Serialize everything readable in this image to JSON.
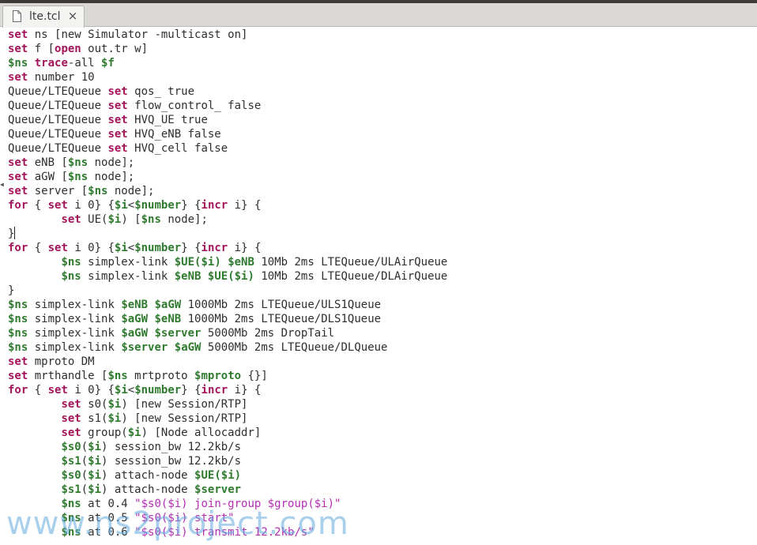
{
  "tab": {
    "title": "lte.tcl",
    "close": "×",
    "icon": "document-icon"
  },
  "watermark": "www.ns2project.com",
  "code": [
    [
      [
        "kw",
        "set"
      ],
      [
        "p",
        " ns [new Simulator -multicast on]"
      ]
    ],
    [
      [
        "kw",
        "set"
      ],
      [
        "p",
        " f ["
      ],
      [
        "kw",
        "open"
      ],
      [
        "p",
        " out.tr w]"
      ]
    ],
    [
      [
        "var",
        "$ns"
      ],
      [
        "p",
        " "
      ],
      [
        "kw",
        "trace"
      ],
      [
        "p",
        "-all "
      ],
      [
        "var",
        "$f"
      ]
    ],
    [
      [
        "kw",
        "set"
      ],
      [
        "p",
        " number 10"
      ]
    ],
    [
      [
        "p",
        "Queue/LTEQueue "
      ],
      [
        "kw",
        "set"
      ],
      [
        "p",
        " qos_ true"
      ]
    ],
    [
      [
        "p",
        "Queue/LTEQueue "
      ],
      [
        "kw",
        "set"
      ],
      [
        "p",
        " flow_control_ false"
      ]
    ],
    [
      [
        "p",
        "Queue/LTEQueue "
      ],
      [
        "kw",
        "set"
      ],
      [
        "p",
        " HVQ_UE true"
      ]
    ],
    [
      [
        "p",
        "Queue/LTEQueue "
      ],
      [
        "kw",
        "set"
      ],
      [
        "p",
        " HVQ_eNB false"
      ]
    ],
    [
      [
        "p",
        "Queue/LTEQueue "
      ],
      [
        "kw",
        "set"
      ],
      [
        "p",
        " HVQ_cell false"
      ]
    ],
    [
      [
        "kw",
        "set"
      ],
      [
        "p",
        " eNB ["
      ],
      [
        "var",
        "$ns"
      ],
      [
        "p",
        " node];"
      ]
    ],
    [
      [
        "kw",
        "set"
      ],
      [
        "p",
        " aGW ["
      ],
      [
        "var",
        "$ns"
      ],
      [
        "p",
        " node];"
      ]
    ],
    [
      [
        "kw",
        "set"
      ],
      [
        "p",
        " server ["
      ],
      [
        "var",
        "$ns"
      ],
      [
        "p",
        " node];"
      ]
    ],
    [
      [
        "kw",
        "for"
      ],
      [
        "p",
        " { "
      ],
      [
        "kw",
        "set"
      ],
      [
        "p",
        " i 0} {"
      ],
      [
        "var",
        "$i"
      ],
      [
        "p",
        "<"
      ],
      [
        "var",
        "$number"
      ],
      [
        "p",
        "} {"
      ],
      [
        "kw",
        "incr"
      ],
      [
        "p",
        " i} {"
      ]
    ],
    [
      [
        "p",
        "        "
      ],
      [
        "kw",
        "set"
      ],
      [
        "p",
        " UE("
      ],
      [
        "var",
        "$i"
      ],
      [
        "p",
        ") ["
      ],
      [
        "var",
        "$ns"
      ],
      [
        "p",
        " node];"
      ]
    ],
    [
      [
        "p",
        "}"
      ],
      [
        "cursor",
        ""
      ]
    ],
    [
      [
        "kw",
        "for"
      ],
      [
        "p",
        " { "
      ],
      [
        "kw",
        "set"
      ],
      [
        "p",
        " i 0} {"
      ],
      [
        "var",
        "$i"
      ],
      [
        "p",
        "<"
      ],
      [
        "var",
        "$number"
      ],
      [
        "p",
        "} {"
      ],
      [
        "kw",
        "incr"
      ],
      [
        "p",
        " i} {"
      ]
    ],
    [
      [
        "p",
        "        "
      ],
      [
        "var",
        "$ns"
      ],
      [
        "p",
        " simplex-link "
      ],
      [
        "var",
        "$UE($i)"
      ],
      [
        "p",
        " "
      ],
      [
        "var",
        "$eNB"
      ],
      [
        "p",
        " 10Mb 2ms LTEQueue/ULAirQueue"
      ]
    ],
    [
      [
        "p",
        "        "
      ],
      [
        "var",
        "$ns"
      ],
      [
        "p",
        " simplex-link "
      ],
      [
        "var",
        "$eNB"
      ],
      [
        "p",
        " "
      ],
      [
        "var",
        "$UE($i)"
      ],
      [
        "p",
        " 10Mb 2ms LTEQueue/DLAirQueue"
      ]
    ],
    [
      [
        "p",
        "}"
      ]
    ],
    [
      [
        "var",
        "$ns"
      ],
      [
        "p",
        " simplex-link "
      ],
      [
        "var",
        "$eNB"
      ],
      [
        "p",
        " "
      ],
      [
        "var",
        "$aGW"
      ],
      [
        "p",
        " 1000Mb 2ms LTEQueue/ULS1Queue"
      ]
    ],
    [
      [
        "var",
        "$ns"
      ],
      [
        "p",
        " simplex-link "
      ],
      [
        "var",
        "$aGW"
      ],
      [
        "p",
        " "
      ],
      [
        "var",
        "$eNB"
      ],
      [
        "p",
        " 1000Mb 2ms LTEQueue/DLS1Queue"
      ]
    ],
    [
      [
        "var",
        "$ns"
      ],
      [
        "p",
        " simplex-link "
      ],
      [
        "var",
        "$aGW"
      ],
      [
        "p",
        " "
      ],
      [
        "var",
        "$server"
      ],
      [
        "p",
        " 5000Mb 2ms DropTail"
      ]
    ],
    [
      [
        "var",
        "$ns"
      ],
      [
        "p",
        " simplex-link "
      ],
      [
        "var",
        "$server"
      ],
      [
        "p",
        " "
      ],
      [
        "var",
        "$aGW"
      ],
      [
        "p",
        " 5000Mb 2ms LTEQueue/DLQueue"
      ]
    ],
    [
      [
        "kw",
        "set"
      ],
      [
        "p",
        " mproto DM"
      ]
    ],
    [
      [
        "kw",
        "set"
      ],
      [
        "p",
        " mrthandle ["
      ],
      [
        "var",
        "$ns"
      ],
      [
        "p",
        " mrtproto "
      ],
      [
        "var",
        "$mproto"
      ],
      [
        "p",
        " {}]"
      ]
    ],
    [
      [
        "kw",
        "for"
      ],
      [
        "p",
        " { "
      ],
      [
        "kw",
        "set"
      ],
      [
        "p",
        " i 0} {"
      ],
      [
        "var",
        "$i"
      ],
      [
        "p",
        "<"
      ],
      [
        "var",
        "$number"
      ],
      [
        "p",
        "} {"
      ],
      [
        "kw",
        "incr"
      ],
      [
        "p",
        " i} {"
      ]
    ],
    [
      [
        "p",
        "        "
      ],
      [
        "kw",
        "set"
      ],
      [
        "p",
        " s0("
      ],
      [
        "var",
        "$i"
      ],
      [
        "p",
        ") [new Session/RTP]"
      ]
    ],
    [
      [
        "p",
        "        "
      ],
      [
        "kw",
        "set"
      ],
      [
        "p",
        " s1("
      ],
      [
        "var",
        "$i"
      ],
      [
        "p",
        ") [new Session/RTP]"
      ]
    ],
    [
      [
        "p",
        "        "
      ],
      [
        "kw",
        "set"
      ],
      [
        "p",
        " group("
      ],
      [
        "var",
        "$i"
      ],
      [
        "p",
        ") [Node allocaddr]"
      ]
    ],
    [
      [
        "p",
        "        "
      ],
      [
        "var",
        "$s0"
      ],
      [
        "p",
        "("
      ],
      [
        "var",
        "$i"
      ],
      [
        "p",
        ") session_bw 12.2kb/s"
      ]
    ],
    [
      [
        "p",
        "        "
      ],
      [
        "var",
        "$s1"
      ],
      [
        "p",
        "("
      ],
      [
        "var",
        "$i"
      ],
      [
        "p",
        ") session_bw 12.2kb/s"
      ]
    ],
    [
      [
        "p",
        "        "
      ],
      [
        "var",
        "$s0"
      ],
      [
        "p",
        "("
      ],
      [
        "var",
        "$i"
      ],
      [
        "p",
        ") attach-node "
      ],
      [
        "var",
        "$UE($i)"
      ]
    ],
    [
      [
        "p",
        "        "
      ],
      [
        "var",
        "$s1"
      ],
      [
        "p",
        "("
      ],
      [
        "var",
        "$i"
      ],
      [
        "p",
        ") attach-node "
      ],
      [
        "var",
        "$server"
      ]
    ],
    [
      [
        "p",
        "        "
      ],
      [
        "var",
        "$ns"
      ],
      [
        "p",
        " at 0.4 "
      ],
      [
        "str",
        "\"$s0($i) join-group $group($i)\""
      ]
    ],
    [
      [
        "p",
        "        "
      ],
      [
        "var",
        "$ns"
      ],
      [
        "p",
        " at 0.5 "
      ],
      [
        "str",
        "\"$s0($i) start\""
      ]
    ],
    [
      [
        "p",
        "        "
      ],
      [
        "var",
        "$ns"
      ],
      [
        "p",
        " at 0.6 "
      ],
      [
        "str",
        "\"$s0($i) transmit 12.2kb/s\""
      ]
    ]
  ]
}
